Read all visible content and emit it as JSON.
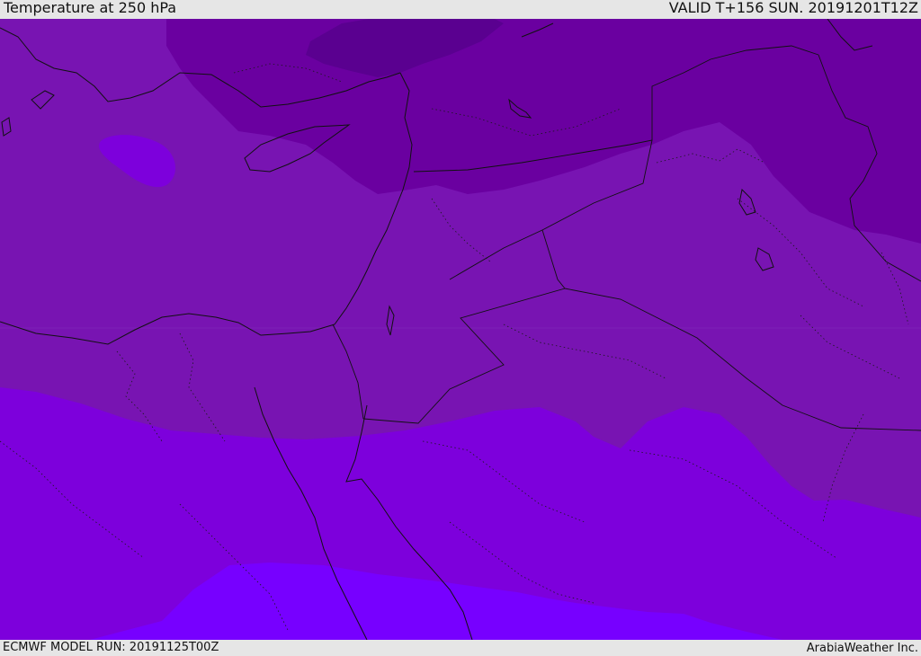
{
  "header": {
    "title": "Temperature at 250 hPa",
    "valid": "VALID T+156 SUN. 20191201T12Z"
  },
  "footer": {
    "model_run": "ECMWF MODEL RUN: 20191125T00Z",
    "credit": "ArabiaWeather Inc."
  },
  "map": {
    "colors": {
      "band_coldest": "#5a0090",
      "band_cold": "#6a00a0",
      "band_mid": "#7814b2",
      "band_warm": "#7d00dc",
      "band_warmest": "#7700ff",
      "coastline": "#111111",
      "border": "#222222"
    }
  }
}
